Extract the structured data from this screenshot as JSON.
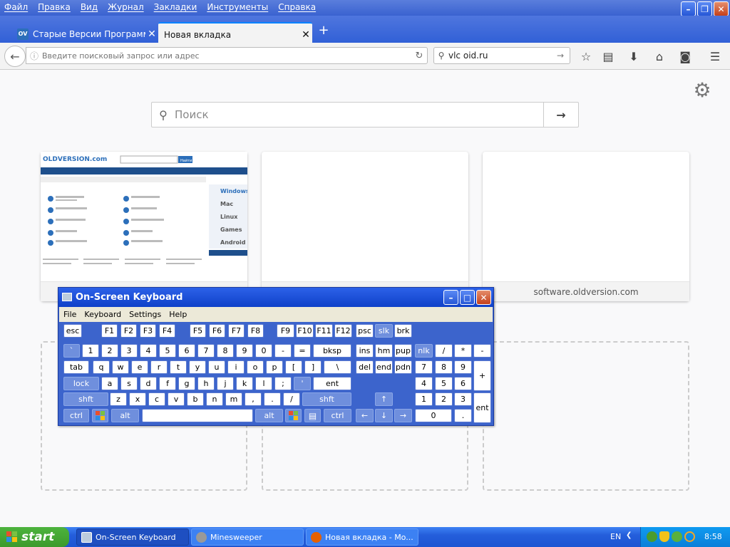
{
  "browser": {
    "menu": [
      "Файл",
      "Правка",
      "Вид",
      "Журнал",
      "Закладки",
      "Инструменты",
      "Справка"
    ],
    "tabs": [
      {
        "label": "Старые Версии Программно...",
        "favicon": "OV",
        "active": false
      },
      {
        "label": "Новая вкладка",
        "active": true
      }
    ],
    "url_placeholder": "Введите поисковый запрос или адрес",
    "search_value": "vlc oid.ru",
    "newtab_search_placeholder": "Поиск",
    "tiles": [
      {
        "caption": "",
        "thumb": "oldversion"
      },
      {
        "caption": ""
      },
      {
        "caption": "software.oldversion.com"
      }
    ]
  },
  "oldversion_thumb": {
    "logo": "OLDVERSION.com",
    "nav": [
      "Windows",
      "Mac",
      "Linux",
      "Games",
      "Android"
    ],
    "search_btn": "Найти"
  },
  "osk": {
    "title": "On-Screen Keyboard",
    "menu": [
      "File",
      "Keyboard",
      "Settings",
      "Help"
    ],
    "rows": {
      "fn": [
        "esc",
        "F1",
        "F2",
        "F3",
        "F4",
        "F5",
        "F6",
        "F7",
        "F8",
        "F9",
        "F10",
        "F11",
        "F12",
        "psc",
        "slk",
        "brk"
      ],
      "num": [
        "`",
        "1",
        "2",
        "3",
        "4",
        "5",
        "6",
        "7",
        "8",
        "9",
        "0",
        "-",
        "=",
        "bksp",
        "ins",
        "hm",
        "pup",
        "nlk",
        "/",
        "*",
        "-"
      ],
      "q": [
        "tab",
        "q",
        "w",
        "e",
        "r",
        "t",
        "y",
        "u",
        "i",
        "o",
        "p",
        "[",
        "]",
        "\\",
        "del",
        "end",
        "pdn",
        "7",
        "8",
        "9",
        "+"
      ],
      "a": [
        "lock",
        "a",
        "s",
        "d",
        "f",
        "g",
        "h",
        "j",
        "k",
        "l",
        ";",
        "'",
        "ent",
        "4",
        "5",
        "6"
      ],
      "z": [
        "shft",
        "z",
        "x",
        "c",
        "v",
        "b",
        "n",
        "m",
        ",",
        ".",
        "/",
        "shft",
        "↑",
        "1",
        "2",
        "3",
        "ent"
      ],
      "bottom": [
        "ctrl",
        "alt",
        "alt",
        "ctrl",
        "←",
        "↓",
        "→",
        "0",
        "."
      ]
    }
  },
  "taskbar": {
    "start": "start",
    "tasks": [
      {
        "label": "On-Screen Keyboard",
        "active": true
      },
      {
        "label": "Minesweeper",
        "active": false
      },
      {
        "label": "Новая вкладка - Mo...",
        "active": false
      }
    ],
    "lang": "EN",
    "time": "8:58"
  }
}
